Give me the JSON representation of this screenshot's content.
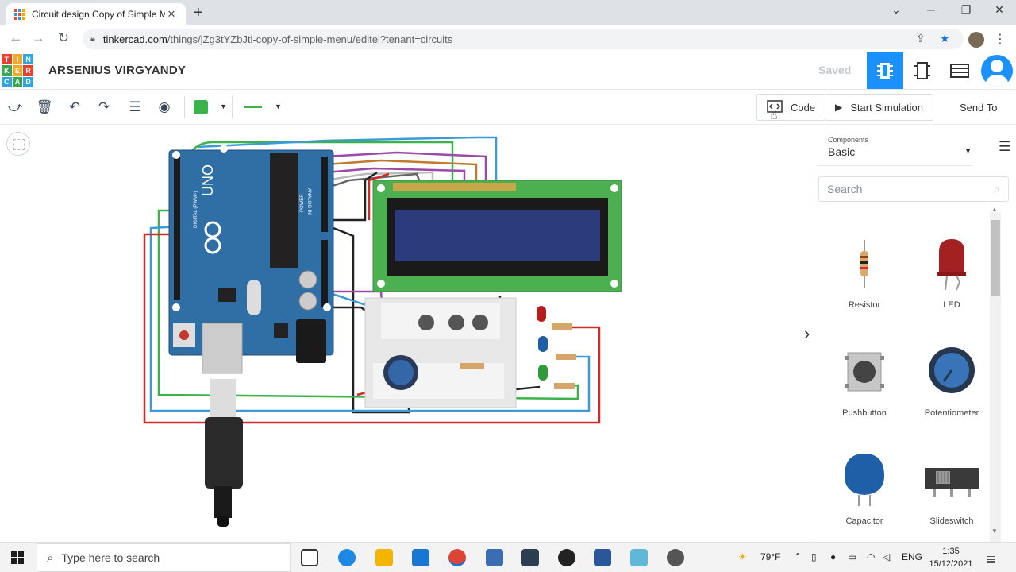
{
  "browser": {
    "tab_title": "Circuit design Copy of Simple Me",
    "tab_close": "✕",
    "new_tab": "+",
    "url_domain": "tinkercad.com",
    "url_path": "/things/jZg3tYZbJtl-copy-of-simple-menu/editel?tenant=circuits"
  },
  "app": {
    "logo_letters": [
      "T",
      "I",
      "N",
      "K",
      "E",
      "R",
      "C",
      "A",
      "D"
    ],
    "logo_colors": [
      "#e5412f",
      "#f1a92c",
      "#32a4da",
      "#3aa655",
      "#f1a92c",
      "#e5412f",
      "#32a4da",
      "#3aa655",
      "#32a4da"
    ],
    "username": "ARSENIUS VIRGYANDY",
    "save_status": "Saved",
    "accent": "#1a91ff"
  },
  "toolbar": {
    "code_label": "Code",
    "start_sim_label": "Start Simulation",
    "send_to_label": "Send To",
    "wire_color": "#3bb34a"
  },
  "panel": {
    "components_label": "Components",
    "components_value": "Basic",
    "search_placeholder": "Search",
    "items": [
      {
        "name": "Resistor"
      },
      {
        "name": "LED"
      },
      {
        "name": "Pushbutton"
      },
      {
        "name": "Potentiometer"
      },
      {
        "name": "Capacitor"
      },
      {
        "name": "Slideswitch"
      }
    ]
  },
  "canvas": {
    "board_brand": "UNO",
    "board_digital_label": "DIGITAL (PWM~)",
    "board_analog_label": "ANALOG IN",
    "board_power_label": "POWER"
  },
  "taskbar": {
    "search_placeholder": "Type here to search",
    "weather": "79°F",
    "lang": "ENG",
    "time": "1:35",
    "date": "15/12/2021"
  }
}
